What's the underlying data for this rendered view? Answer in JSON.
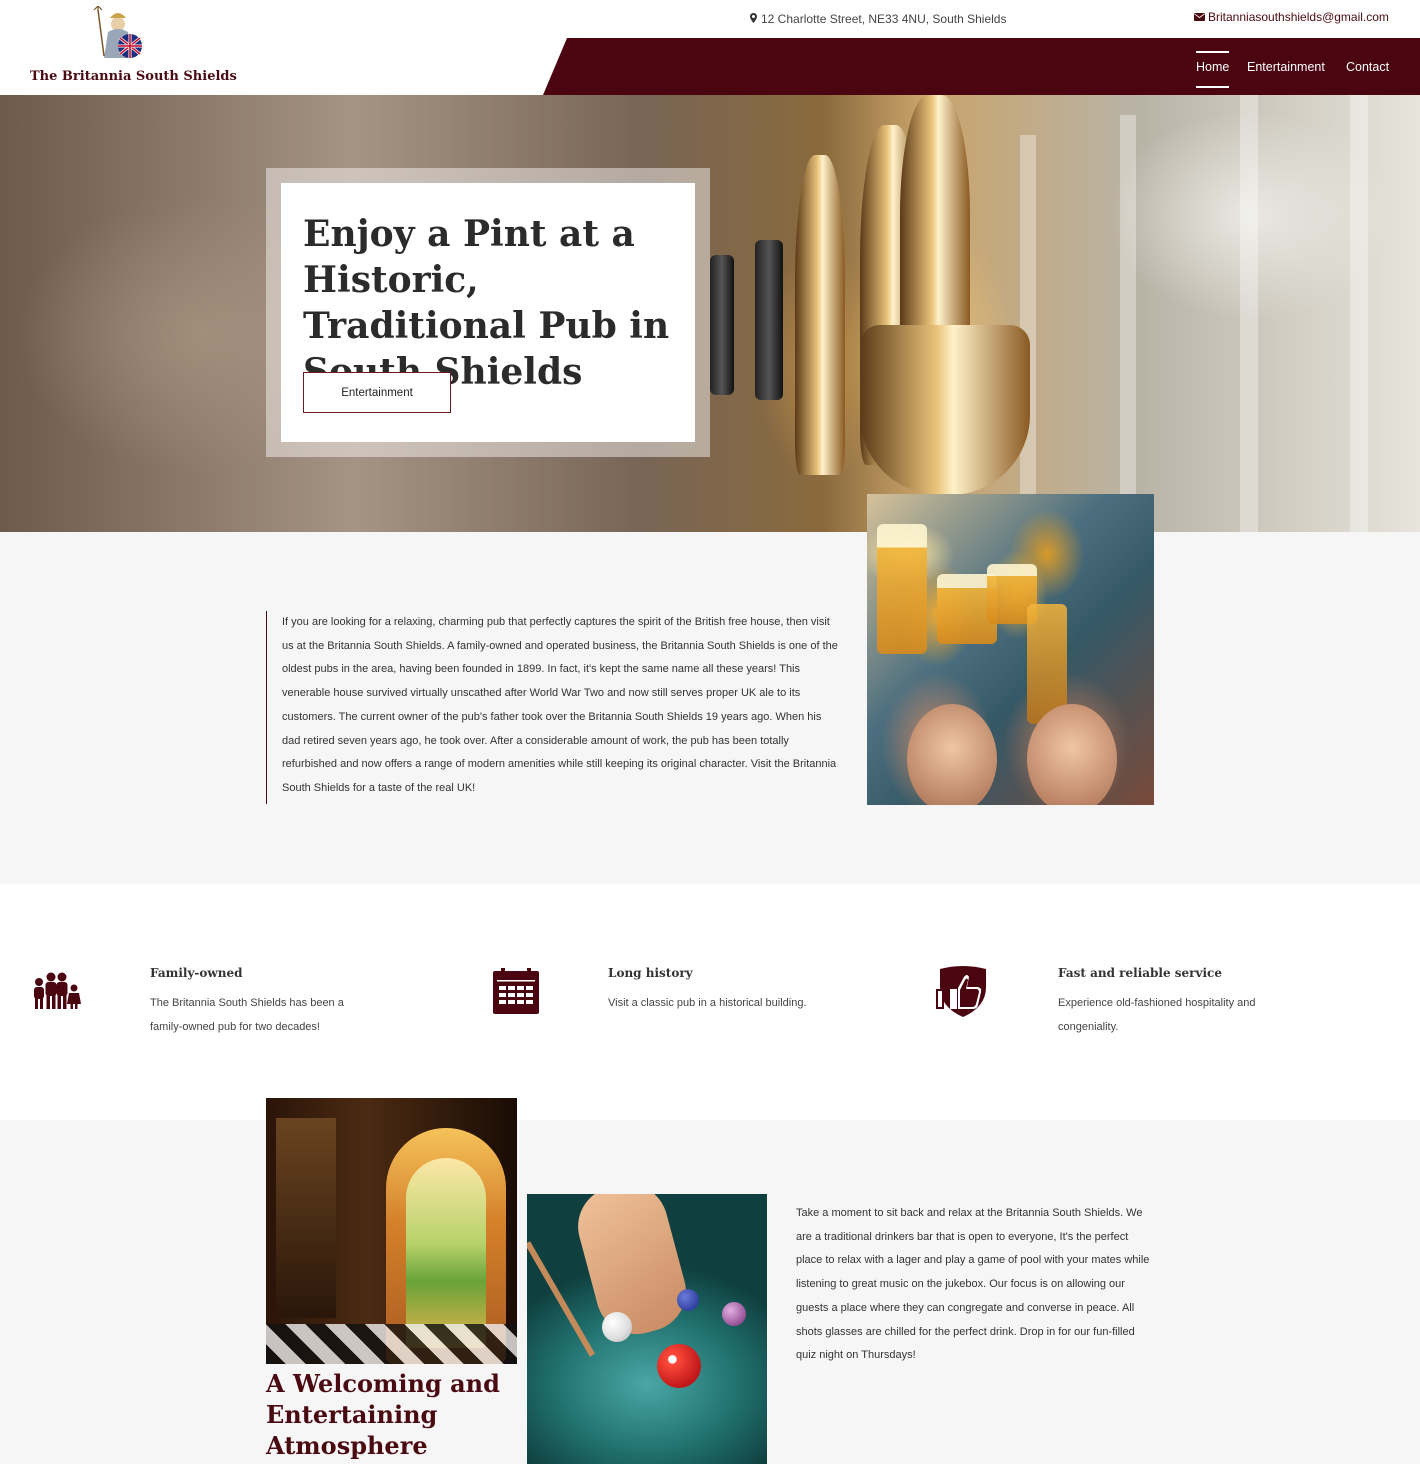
{
  "header": {
    "logo_text": "The Britannia South Shields",
    "address": "12 Charlotte Street, NE33 4NU, South Shields",
    "email": "Britanniasouthshields@gmail.com",
    "nav": [
      {
        "label": "Home",
        "active": true
      },
      {
        "label": "Entertainment",
        "active": false
      },
      {
        "label": "Contact",
        "active": false
      }
    ]
  },
  "hero": {
    "title": "Enjoy a Pint at a Historic, Traditional Pub in South Shields",
    "button_label": "Entertainment"
  },
  "about": {
    "text": "If you are looking for a relaxing, charming pub that perfectly captures the spirit of the British free house, then visit us at the Britannia South Shields. A family-owned and operated business, the Britannia South Shields is one of the oldest pubs in the area, having been founded in 1899. In fact, it's kept the same name all these years! This venerable house survived virtually unscathed after World War Two and now still serves proper UK ale to its customers. The current owner of the pub's father took over the Britannia South Shields 19 years ago. When his dad retired seven years ago, he took over. After a considerable amount of work, the pub has been totally refurbished and now offers a range of modern amenities while still keeping its original character. Visit the Britannia South Shields for a taste of the real UK!"
  },
  "features": [
    {
      "icon": "family-icon",
      "title": "Family-owned",
      "desc": "The Britannia South Shields has been a family-owned pub for two decades!"
    },
    {
      "icon": "calendar-icon",
      "title": "Long history",
      "desc": "Visit a classic pub in a historical building."
    },
    {
      "icon": "thumbs-up-shield-icon",
      "title": "Fast and reliable service",
      "desc": "Experience old-fashioned hospitality and congeniality."
    }
  ],
  "atmosphere": {
    "title": "A Welcoming and Entertaining Atmosphere",
    "text": "Take a moment to sit back and relax at the Britannia South Shields. We are a traditional drinkers bar that is open to everyone, It's the perfect place to relax with a lager and play a game of pool with your mates while listening to great music on the jukebox.  Our focus is on allowing our guests a place where they can congregate and converse in peace. All shots glasses are chilled for the perfect drink. Drop in for our fun-filled quiz night on Thursdays!"
  },
  "colors": {
    "brand": "#4a0510",
    "accent_text": "#4a0a12",
    "light_section": "#f6f6f6"
  }
}
